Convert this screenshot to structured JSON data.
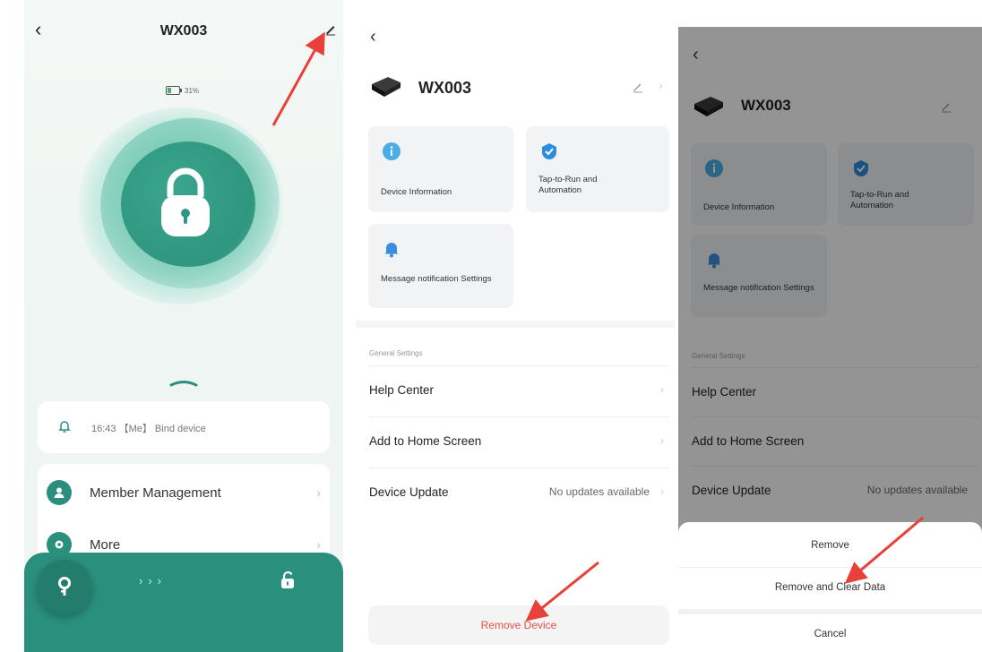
{
  "panel1": {
    "title": "WX003",
    "battery_text": "31%",
    "battery_level_percent": 31,
    "notification": "16:43 【Me】 Bind device",
    "menu": [
      {
        "label": "Member Management",
        "icon": "person-icon"
      },
      {
        "label": "More",
        "icon": "gear-icon"
      }
    ],
    "accent_color": "#2a8f7d"
  },
  "panel2": {
    "device_name": "WX003",
    "tiles": [
      {
        "label": "Device Information",
        "icon": "info-icon"
      },
      {
        "label": "Tap-to-Run and Automation",
        "icon": "check-shield-icon"
      },
      {
        "label": "Message notification Settings",
        "icon": "bell-icon"
      }
    ],
    "section_title": "General Settings",
    "settings": [
      {
        "label": "Help Center",
        "value": ""
      },
      {
        "label": "Add to Home Screen",
        "value": ""
      },
      {
        "label": "Device Update",
        "value": "No updates available"
      }
    ],
    "remove_label": "Remove Device",
    "danger_color": "#e5514a"
  },
  "panel3": {
    "device_name": "WX003",
    "tiles": [
      {
        "label": "Device Information"
      },
      {
        "label": "Tap-to-Run and Automation"
      },
      {
        "label": "Message notification Settings"
      }
    ],
    "section_title": "General Settings",
    "settings": [
      {
        "label": "Help Center",
        "value": ""
      },
      {
        "label": "Add to Home Screen",
        "value": ""
      },
      {
        "label": "Device Update",
        "value": "No updates available"
      }
    ],
    "sheet": {
      "remove": "Remove",
      "remove_clear": "Remove and Clear Data",
      "cancel": "Cancel"
    }
  },
  "annotation_color": "#e8403a"
}
